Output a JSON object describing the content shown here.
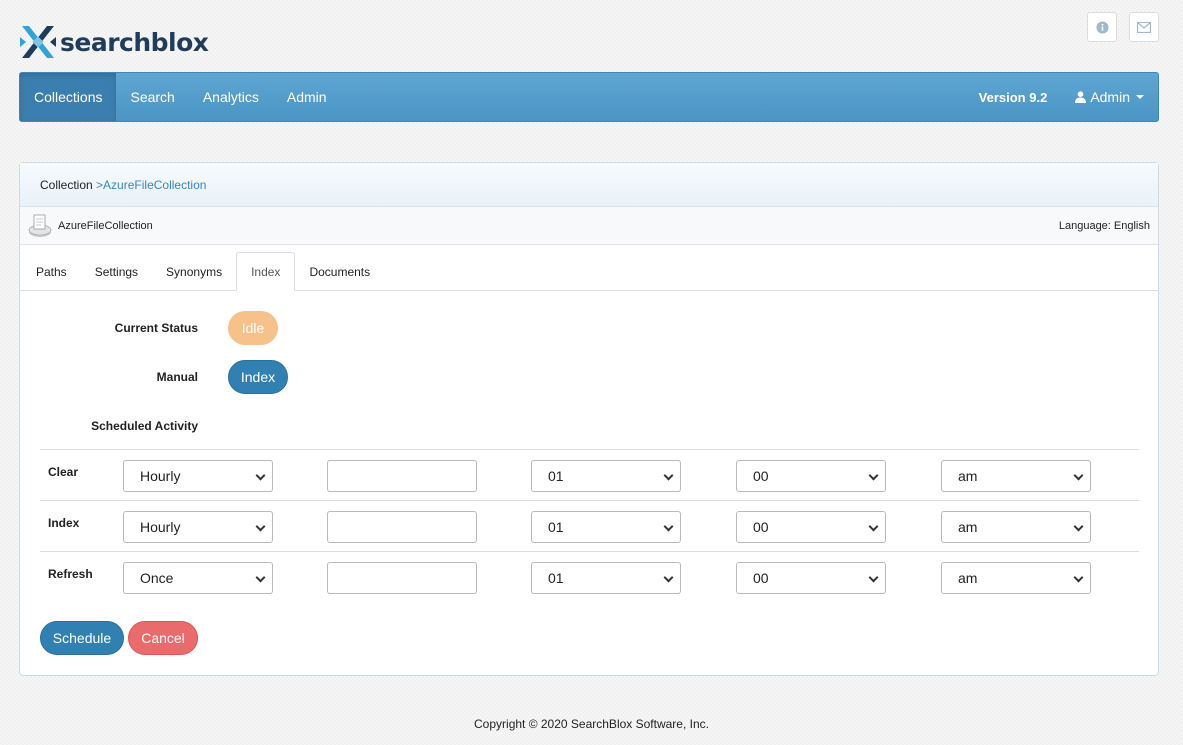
{
  "brand": {
    "name": "searchblox"
  },
  "top_icons": [
    {
      "icon": "info-icon"
    },
    {
      "icon": "mail-icon"
    }
  ],
  "nav": {
    "items": [
      {
        "label": "Collections",
        "active": true
      },
      {
        "label": "Search",
        "active": false
      },
      {
        "label": "Analytics",
        "active": false
      },
      {
        "label": "Admin",
        "active": false
      }
    ],
    "version": "Version 9.2",
    "user_menu": "Admin"
  },
  "breadcrumb": {
    "root": "Collection",
    "current": ">AzureFileCollection"
  },
  "collection": {
    "name": "AzureFileCollection",
    "language": "Language: English"
  },
  "tabs": [
    {
      "label": "Paths",
      "active": false
    },
    {
      "label": "Settings",
      "active": false
    },
    {
      "label": "Synonyms",
      "active": false
    },
    {
      "label": "Index",
      "active": true
    },
    {
      "label": "Documents",
      "active": false
    }
  ],
  "status": {
    "current_status_label": "Current Status",
    "current_status_value": "Idle",
    "manual_label": "Manual",
    "manual_button": "Index",
    "scheduled_label": "Scheduled Activity"
  },
  "schedule": [
    {
      "label": "Clear",
      "frequency": "Hourly",
      "date": "",
      "hour": "01",
      "minute": "00",
      "ampm": "am"
    },
    {
      "label": "Index",
      "frequency": "Hourly",
      "date": "",
      "hour": "01",
      "minute": "00",
      "ampm": "am"
    },
    {
      "label": "Refresh",
      "frequency": "Once",
      "date": "",
      "hour": "01",
      "minute": "00",
      "ampm": "am"
    }
  ],
  "buttons": {
    "schedule": "Schedule",
    "cancel": "Cancel"
  },
  "footer": "Copyright © 2020 SearchBlox Software, Inc.",
  "colors": {
    "nav": "#5fa6d2",
    "primary": "#3180b2",
    "idle": "#f7c18a",
    "danger": "#ea6b6b",
    "logo_dark": "#1f3c5a",
    "logo_accent": "#2fa4d8"
  }
}
